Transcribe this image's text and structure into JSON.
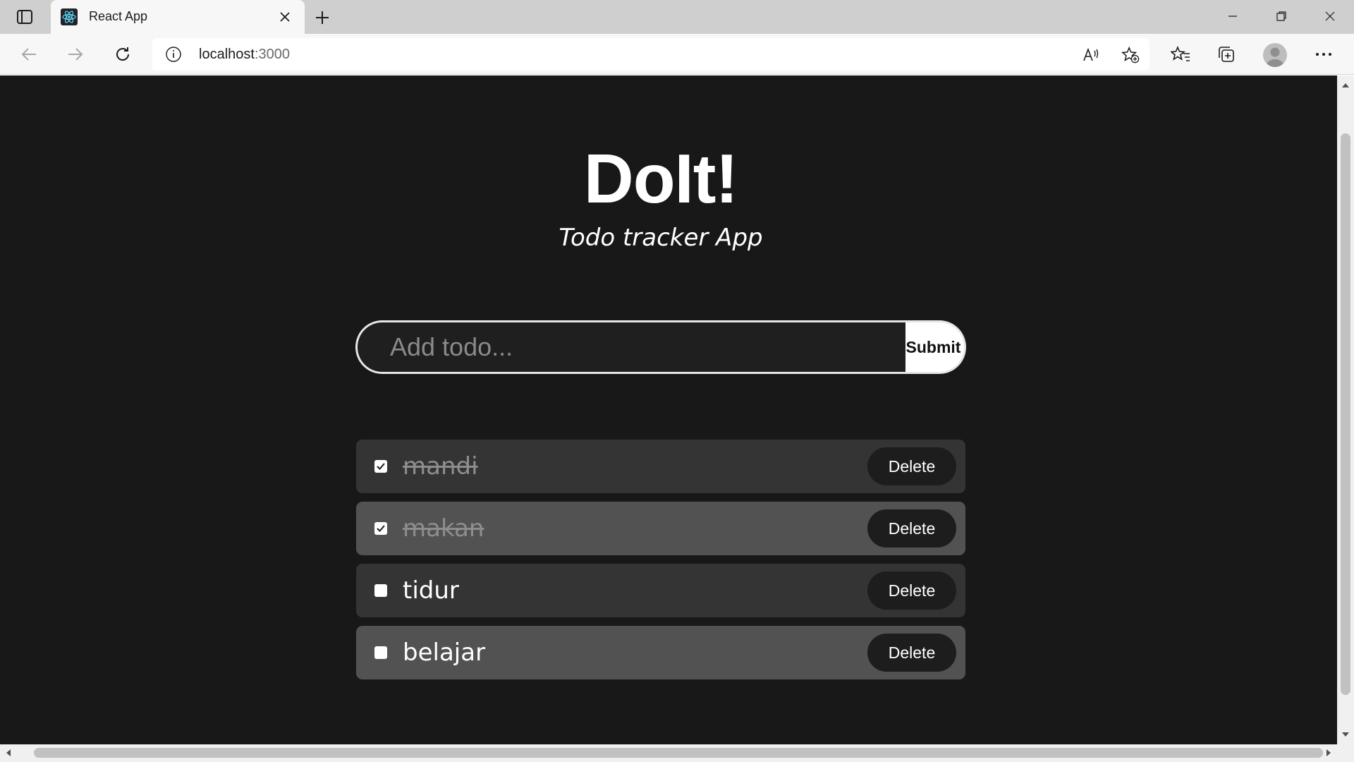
{
  "browser": {
    "tab": {
      "title": "React App",
      "favicon": "react-logo-icon"
    },
    "address": {
      "host": "localhost",
      "port": ":3000"
    },
    "icons": {
      "tab_actions": "tab-actions-icon",
      "close_tab": "close-icon",
      "new_tab": "plus-icon",
      "minimize": "minimize-icon",
      "restore": "restore-icon",
      "close_window": "close-icon",
      "back": "back-arrow-icon",
      "forward": "forward-arrow-icon",
      "refresh": "refresh-icon",
      "site_info": "info-icon",
      "read_aloud": "read-aloud-icon",
      "add_favorite": "add-favorite-icon",
      "favorites": "favorites-icon",
      "collections": "collections-icon",
      "profile": "avatar-icon",
      "more": "more-icon"
    }
  },
  "app": {
    "title": "DoIt!",
    "subtitle": "Todo tracker App",
    "form": {
      "placeholder": "Add todo...",
      "value": "",
      "submit_label": "Submit"
    },
    "todos": [
      {
        "text": "mandi",
        "done": true,
        "delete_label": "Delete"
      },
      {
        "text": "makan",
        "done": true,
        "delete_label": "Delete"
      },
      {
        "text": "tidur",
        "done": false,
        "delete_label": "Delete"
      },
      {
        "text": "belajar",
        "done": false,
        "delete_label": "Delete"
      }
    ]
  },
  "colors": {
    "page_background": "#181818",
    "item_dark": "#343434",
    "item_light": "#525252",
    "button_dark": "#1d1d1d",
    "text_primary": "#ffffff",
    "text_done": "#8d8d8d"
  }
}
